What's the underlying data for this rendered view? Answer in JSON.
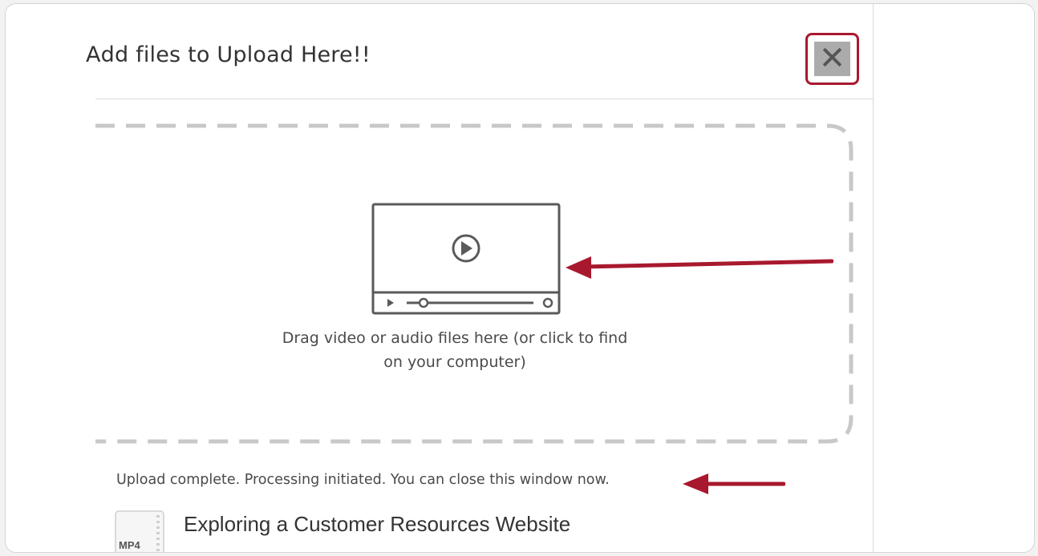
{
  "dialog": {
    "title": "Аdd files to Upload Here!!",
    "close_symbol": "✕"
  },
  "dropzone": {
    "instruction_line1": "Drag video or audio files here (or click to find",
    "instruction_line2": "on your computer)",
    "icon": "video-player-icon"
  },
  "upload": {
    "status_text": "Upload complete. Processing initiated. You can close this window now."
  },
  "file": {
    "type_badge": "MP4",
    "name": "Exploring a Customer Resources Website"
  },
  "colors": {
    "highlight": "#a8192e",
    "dash_border": "#c8c8c8",
    "close_bg": "#ababab"
  }
}
